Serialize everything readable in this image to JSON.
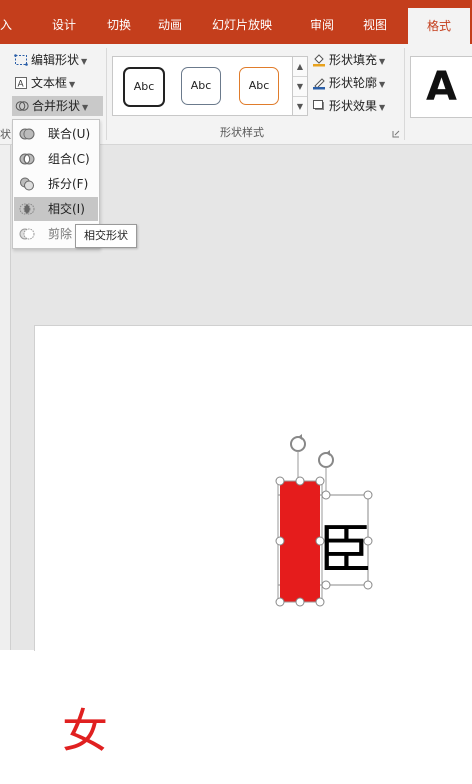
{
  "tabs": [
    {
      "label": "插入",
      "partial": "入"
    },
    {
      "label": "设计"
    },
    {
      "label": "切换"
    },
    {
      "label": "动画"
    },
    {
      "label": "幻灯片放映"
    },
    {
      "label": "审阅"
    },
    {
      "label": "视图"
    },
    {
      "label": "格式",
      "active": true
    }
  ],
  "ribbon": {
    "insert_shapes": {
      "edit_shape": "编辑形状",
      "text_box": "文本框",
      "merge_shapes": "合并形状",
      "group_label_partial": "状"
    },
    "shape_styles": {
      "group_label": "形状样式",
      "presets": [
        "Abc",
        "Abc",
        "Abc"
      ],
      "preset_colors": [
        "#222222",
        "#6b7a8c",
        "#e07c2b"
      ],
      "shape_fill": "形状填充",
      "shape_outline": "形状轮廓",
      "shape_effects": "形状效果"
    },
    "wordart": {
      "preview": "A"
    }
  },
  "merge_menu": {
    "items": [
      {
        "label": "联合(U)",
        "icon": "union-icon"
      },
      {
        "label": "组合(C)",
        "icon": "combine-icon"
      },
      {
        "label": "拆分(F)",
        "icon": "fragment-icon"
      },
      {
        "label": "相交(I)",
        "icon": "intersect-icon",
        "highlighted": true
      },
      {
        "label": "剪除",
        "icon": "subtract-icon",
        "dimmed": true
      }
    ],
    "tooltip": "相交形状"
  },
  "canvas": {
    "text_glyph": "臣",
    "fill_color": "#e51c1c"
  },
  "result_glyph": "女"
}
